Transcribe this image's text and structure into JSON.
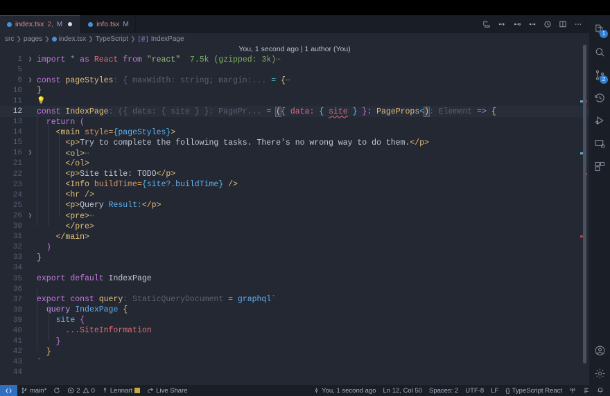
{
  "window": {
    "title": "index.tsx — Visual Studio Code"
  },
  "tabs": [
    {
      "name": "index.tsx",
      "badge": "2,",
      "modified": "M",
      "active": true,
      "dirty": true,
      "icon": "react-file-icon"
    },
    {
      "name": "info.tsx",
      "badge": "",
      "modified": "M",
      "active": false,
      "dirty": false,
      "icon": "react-file-icon"
    }
  ],
  "editor_actions": [
    {
      "name": "split-preview-icon",
      "glyph": "⊐"
    },
    {
      "name": "debug-step-over-icon",
      "glyph": "⟳"
    },
    {
      "name": "debug-step-into-icon",
      "glyph": "⤓"
    },
    {
      "name": "debug-step-out-icon",
      "glyph": "⤒"
    },
    {
      "name": "run-timer-icon",
      "glyph": "◷"
    },
    {
      "name": "split-editor-right-icon",
      "glyph": "▥"
    },
    {
      "name": "more-actions-icon",
      "glyph": "⋯"
    }
  ],
  "breadcrumbs": [
    {
      "label": "src",
      "type": "folder"
    },
    {
      "label": "pages",
      "type": "folder"
    },
    {
      "label": "index.tsx",
      "type": "file"
    },
    {
      "label": "TypeScript",
      "type": "lang"
    },
    {
      "label": "IndexPage",
      "type": "symbol",
      "symbol_glyph": "[@]"
    }
  ],
  "blame": {
    "text": "You, 1 second ago | 1 author (You)"
  },
  "code": {
    "lines": [
      {
        "num": "1",
        "fold": "chevron-right",
        "indent": 0
      },
      {
        "num": "5",
        "fold": "",
        "indent": 0
      },
      {
        "num": "6",
        "fold": "chevron-right",
        "indent": 0
      },
      {
        "num": "10",
        "fold": "",
        "indent": 0
      },
      {
        "num": "11",
        "fold": "",
        "indent": 0
      },
      {
        "num": "12",
        "fold": "",
        "indent": 0,
        "active": true
      },
      {
        "num": "13",
        "fold": "",
        "indent": 1
      },
      {
        "num": "14",
        "fold": "",
        "indent": 2
      },
      {
        "num": "15",
        "fold": "",
        "indent": 3
      },
      {
        "num": "16",
        "fold": "chevron-right",
        "indent": 3
      },
      {
        "num": "21",
        "fold": "",
        "indent": 3
      },
      {
        "num": "22",
        "fold": "",
        "indent": 3
      },
      {
        "num": "23",
        "fold": "",
        "indent": 3
      },
      {
        "num": "24",
        "fold": "",
        "indent": 3
      },
      {
        "num": "25",
        "fold": "",
        "indent": 3
      },
      {
        "num": "26",
        "fold": "chevron-right",
        "indent": 3
      },
      {
        "num": "30",
        "fold": "",
        "indent": 3
      },
      {
        "num": "31",
        "fold": "",
        "indent": 2
      },
      {
        "num": "32",
        "fold": "",
        "indent": 1
      },
      {
        "num": "33",
        "fold": "",
        "indent": 0
      },
      {
        "num": "34",
        "fold": "",
        "indent": 0
      },
      {
        "num": "35",
        "fold": "",
        "indent": 0
      },
      {
        "num": "36",
        "fold": "",
        "indent": 0
      },
      {
        "num": "37",
        "fold": "",
        "indent": 0
      },
      {
        "num": "38",
        "fold": "",
        "indent": 1
      },
      {
        "num": "39",
        "fold": "",
        "indent": 2
      },
      {
        "num": "40",
        "fold": "",
        "indent": 3
      },
      {
        "num": "41",
        "fold": "",
        "indent": 2
      },
      {
        "num": "42",
        "fold": "",
        "indent": 1
      },
      {
        "num": "43",
        "fold": "",
        "indent": 0
      },
      {
        "num": "44",
        "fold": "",
        "indent": 0
      }
    ],
    "line1": {
      "kw": "import",
      "star": "*",
      "as": "as",
      "react": "React",
      "from": "from",
      "module": "\"react\"",
      "cost": "7.5k (gzipped: 3k)",
      "ellipsis": "⋯"
    },
    "line6": {
      "kw": "const",
      "name": "pageStyles",
      "colon": ":",
      "type": "{ maxWidth: string; margin:...",
      "eq": "=",
      "brace": "{",
      "ellipsis": "⋯"
    },
    "line10": {
      "brace": "}"
    },
    "line11": {
      "lamp": "💡"
    },
    "line12": {
      "kw": "const",
      "name": "IndexPage",
      "colon": ":",
      "ghosttype": "({ data: { site } }: PagePr...",
      "eq": "=",
      "p1": "(",
      "b1": "{",
      "data": "data:",
      "b2": "{",
      "site": "site",
      "b3": "}",
      "b4": "}",
      "c2": ":",
      "props": "PageProps",
      "lt": "<",
      "p2": ")",
      "c3": ":",
      "element": "Element",
      "arrow": "=>",
      "b5": "{"
    },
    "line13": {
      "kw": "return",
      "paren": "("
    },
    "line14": {
      "tag": "<main",
      "attr": "style=",
      "brace1": "{",
      "val": "pageStyles",
      "brace2": "}",
      "close": ">"
    },
    "line15": {
      "open": "<p>",
      "text": "Try to complete the following tasks. There's no wrong way to do them.",
      "close": "</p>"
    },
    "line16": {
      "tag": "<ol>",
      "ellipsis": "⋯"
    },
    "line21": {
      "tag": "</ol>"
    },
    "line22": {
      "open": "<p>",
      "text": "Site title: TODO",
      "close": "</p>"
    },
    "line23": {
      "tag": "<Info",
      "attr": "buildTime=",
      "brace1": "{",
      "val": "site?.buildTime",
      "brace2": "}",
      "close": "/>"
    },
    "line24": {
      "tag": "<hr",
      "close": "/>"
    },
    "line25": {
      "open": "<p>",
      "text": "Query ",
      "text2": "Result:",
      "close": "</p>"
    },
    "line26": {
      "tag": "<pre>",
      "ellipsis": "⋯"
    },
    "line30": {
      "tag": "</pre>"
    },
    "line31": {
      "tag": "</main>"
    },
    "line32": {
      "paren": ")"
    },
    "line33": {
      "brace": "}"
    },
    "line35": {
      "kw": "export",
      "kw2": "default",
      "name": "IndexPage"
    },
    "line37": {
      "kw": "export",
      "kw2": "const",
      "name": "query",
      "colon": ":",
      "type": "StaticQueryDocument",
      "eq": "=",
      "tag": "graphql",
      "tick": "`"
    },
    "line38": {
      "kw": "query",
      "name": "IndexPage",
      "brace": "{"
    },
    "line39": {
      "name": "site",
      "brace": "{"
    },
    "line40": {
      "spread": "...SiteInformation"
    },
    "line41": {
      "brace": "}"
    },
    "line42": {
      "brace": "}"
    },
    "line43": {
      "tick": "`"
    }
  },
  "activity_bar": [
    {
      "name": "explorer",
      "icon": "files-icon",
      "badge": "1"
    },
    {
      "name": "search",
      "icon": "search-icon",
      "badge": ""
    },
    {
      "name": "source-control",
      "icon": "source-control-icon",
      "badge": "2"
    },
    {
      "name": "timeline",
      "icon": "history-icon",
      "badge": ""
    },
    {
      "name": "run-and-debug",
      "icon": "run-debug-icon",
      "badge": ""
    },
    {
      "name": "remote-explorer",
      "icon": "remote-icon",
      "badge": ""
    },
    {
      "name": "extensions",
      "icon": "extensions-icon",
      "badge": ""
    }
  ],
  "activity_bar_bottom": [
    {
      "name": "accounts",
      "icon": "account-icon"
    },
    {
      "name": "manage-settings",
      "icon": "gear-icon"
    }
  ],
  "status_bar": {
    "left": [
      {
        "name": "remote-host",
        "icon": "remote-indicator-icon",
        "label": "",
        "accent": "#2f6fbf"
      },
      {
        "name": "git-branch",
        "icon": "source-control-icon",
        "label": "main*"
      },
      {
        "name": "sync-changes",
        "icon": "sync-icon",
        "label": ""
      },
      {
        "name": "problems",
        "icon": "error-warning-icon",
        "label": "2  0",
        "errors": "2",
        "warnings": "0"
      },
      {
        "name": "git-blame-author",
        "icon": "person-icon",
        "label": "Lennart"
      },
      {
        "name": "live-share",
        "icon": "live-share-icon",
        "label": "Live Share"
      }
    ],
    "right": [
      {
        "name": "git-blame-status",
        "icon": "git-commit-icon",
        "label": "You, 1 second ago"
      },
      {
        "name": "cursor-position",
        "label": "Ln 12, Col 50"
      },
      {
        "name": "indentation",
        "label": "Spaces: 2"
      },
      {
        "name": "encoding",
        "label": "UTF-8"
      },
      {
        "name": "end-of-line",
        "label": "LF"
      },
      {
        "name": "language-mode",
        "label": "TypeScript React",
        "icon": "braces-icon"
      },
      {
        "name": "ports-forwarded",
        "icon": "radio-tower-icon",
        "label": ""
      },
      {
        "name": "prettier",
        "icon": "prettier-icon",
        "label": ""
      },
      {
        "name": "notifications",
        "icon": "bell-icon",
        "label": ""
      }
    ]
  },
  "colors": {
    "editor_bg": "#232833",
    "tabbar_bg": "#191d26",
    "activitybar_bg": "#1a1e27",
    "statusbar_bg": "#1a1e27",
    "accent_blue": "#2f6fbf",
    "active_line": "#282d3a"
  }
}
